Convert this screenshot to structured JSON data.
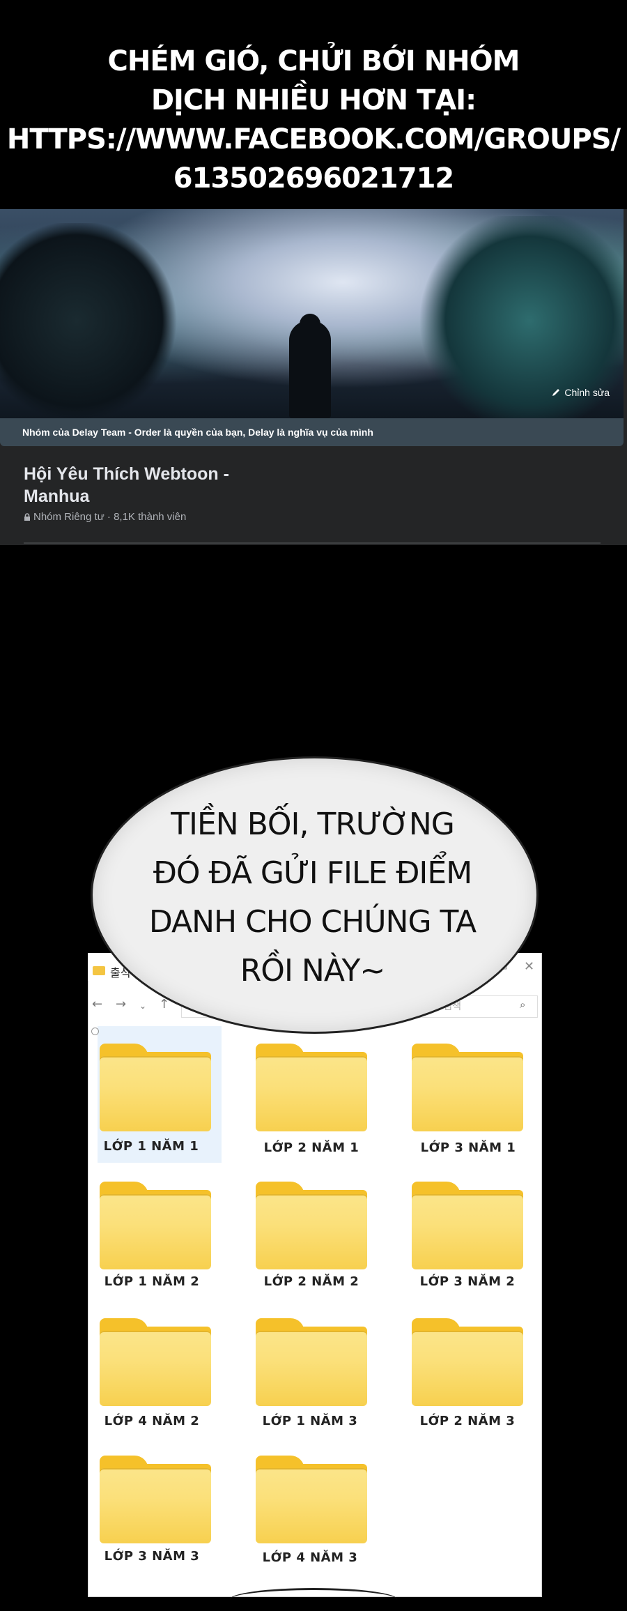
{
  "promo": {
    "lines": [
      "CHÉM GIÓ, CHỬI BỚI NHÓM",
      "DỊCH NHIỀU HƠN TẠI:",
      "HTTPS://WWW.FACEBOOK.COM/GROUPS/",
      "613502696021712"
    ]
  },
  "facebook_group": {
    "edit_label": "Chỉnh sửa",
    "description": "Nhóm của Delay Team - Order là quyền của bạn, Delay là nghĩa vụ của mình",
    "name_line1": "Hội Yêu Thích Webtoon -",
    "name_line2": "Manhua",
    "meta": "Nhóm Riêng tư · 8,1K thành viên"
  },
  "speech_bubble": {
    "lines": [
      "TIỀN BỐI, TRƯỜNG",
      "ĐÓ ĐÃ GỬI FILE ĐIỂM",
      "DANH CHO CHÚNG TA",
      "RỒI NÀY~"
    ]
  },
  "explorer": {
    "title": "출석",
    "search_placeholder": "석부 검색",
    "folders": [
      {
        "label": "LỚP 1 NĂM 1"
      },
      {
        "label": "LỚP 2 NĂM 1"
      },
      {
        "label": "LỚP 3 NĂM 1"
      },
      {
        "label": "LỚP 1 NĂM 2"
      },
      {
        "label": "LỚP 2 NĂM 2"
      },
      {
        "label": "LỚP 3 NĂM 2"
      },
      {
        "label": "LỚP 4 NĂM 2"
      },
      {
        "label": "LỚP 1 NĂM 3"
      },
      {
        "label": "LỚP 2 NĂM 3"
      },
      {
        "label": "LỚP 3 NĂM 3"
      },
      {
        "label": "LỚP 4 NĂM 3"
      }
    ]
  },
  "colors": {
    "background": "#000000",
    "folder_yellow": "#fbe07a",
    "fb_dark": "#242526"
  }
}
